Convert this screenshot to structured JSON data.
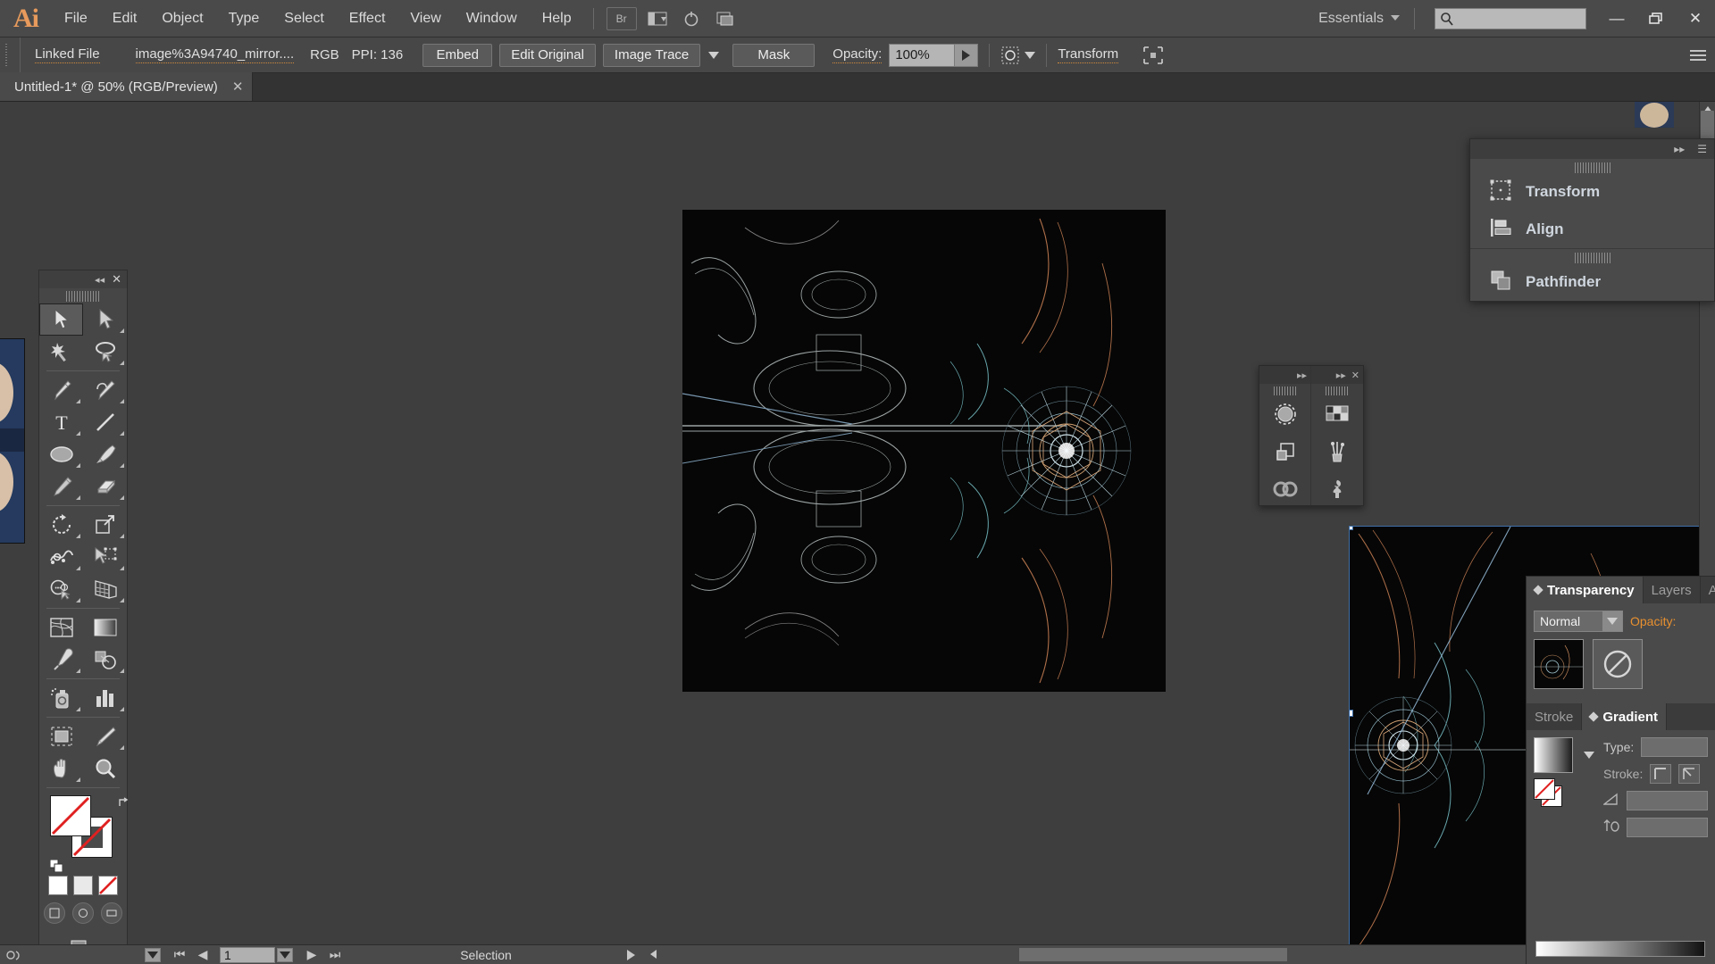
{
  "app": {
    "name": "Ai",
    "logo_text": "Ai"
  },
  "menubar": {
    "items": [
      "File",
      "Edit",
      "Object",
      "Type",
      "Select",
      "Effect",
      "View",
      "Window",
      "Help"
    ],
    "bridge_label": "Br",
    "workspace": "Essentials",
    "search_placeholder": "",
    "search_icon": "search-icon",
    "window_controls": {
      "minimize": "—",
      "restore": "❐",
      "close": "✕"
    }
  },
  "controlbar": {
    "link_status": "Linked File",
    "file_name": "image%3A94740_mirror....",
    "color_mode": "RGB",
    "ppi": "PPI: 136",
    "embed": "Embed",
    "edit_original": "Edit Original",
    "image_trace": "Image Trace",
    "mask": "Mask",
    "opacity_label": "Opacity:",
    "opacity_value": "100%",
    "transform": "Transform",
    "accent_color": "#e8902f"
  },
  "document_tab": {
    "title": "Untitled-1* @ 50% (RGB/Preview)",
    "close": "✕"
  },
  "toolbox": {
    "collapse": "◂◂",
    "close": "✕",
    "tools": [
      {
        "name": "selection-tool",
        "selected": true
      },
      {
        "name": "direct-selection-tool",
        "selected": false
      },
      {
        "name": "magic-wand-tool",
        "selected": false
      },
      {
        "name": "lasso-tool",
        "selected": false
      },
      {
        "name": "pen-tool",
        "selected": false
      },
      {
        "name": "curvature-tool",
        "selected": false
      },
      {
        "name": "type-tool",
        "selected": false
      },
      {
        "name": "line-segment-tool",
        "selected": false
      },
      {
        "name": "ellipse-tool",
        "selected": false
      },
      {
        "name": "paintbrush-tool",
        "selected": false
      },
      {
        "name": "pencil-tool",
        "selected": false
      },
      {
        "name": "eraser-tool",
        "selected": false
      },
      {
        "name": "rotate-tool",
        "selected": false
      },
      {
        "name": "scale-tool",
        "selected": false
      },
      {
        "name": "width-tool",
        "selected": false
      },
      {
        "name": "free-transform-tool",
        "selected": false
      },
      {
        "name": "shape-builder-tool",
        "selected": false
      },
      {
        "name": "perspective-grid-tool",
        "selected": false
      },
      {
        "name": "mesh-tool",
        "selected": false
      },
      {
        "name": "gradient-tool",
        "selected": false
      },
      {
        "name": "eyedropper-tool",
        "selected": false
      },
      {
        "name": "blend-tool",
        "selected": false
      },
      {
        "name": "symbol-sprayer-tool",
        "selected": false
      },
      {
        "name": "column-graph-tool",
        "selected": false
      },
      {
        "name": "artboard-tool",
        "selected": false
      },
      {
        "name": "slice-tool",
        "selected": false
      },
      {
        "name": "hand-tool",
        "selected": false
      },
      {
        "name": "zoom-tool",
        "selected": false
      }
    ]
  },
  "flyout_panel": {
    "collapse": "▸▸",
    "items": [
      {
        "label": "Transform",
        "icon": "transform-icon"
      },
      {
        "label": "Align",
        "icon": "align-icon"
      },
      {
        "label": "Pathfinder",
        "icon": "pathfinder-icon"
      }
    ]
  },
  "mini_dock": {
    "collapse": "▸▸",
    "close": "✕",
    "left_icons": [
      "brushes-icon",
      "symbols-icon",
      "creative-cloud-libraries-icon"
    ],
    "right_icons": [
      "swatches-icon",
      "brush-libraries-icon",
      "symbol-libraries-icon"
    ]
  },
  "right_dock": {
    "tabs_top": [
      {
        "label": "Transparency",
        "active": true
      },
      {
        "label": "Layers",
        "active": false
      },
      {
        "label": "A",
        "active": false
      }
    ],
    "blend_mode": "Normal",
    "opacity_label": "Opacity:",
    "tabs_bottom": [
      {
        "label": "Stroke",
        "active": false
      },
      {
        "label": "Gradient",
        "active": true
      }
    ],
    "type_label": "Type:",
    "stroke_label": "Stroke:"
  },
  "statusbar": {
    "page_number": "1",
    "tool_status": "Selection",
    "nav_first": "⏮",
    "nav_prev": "◀",
    "nav_next": "▶",
    "nav_last": "⏭"
  }
}
